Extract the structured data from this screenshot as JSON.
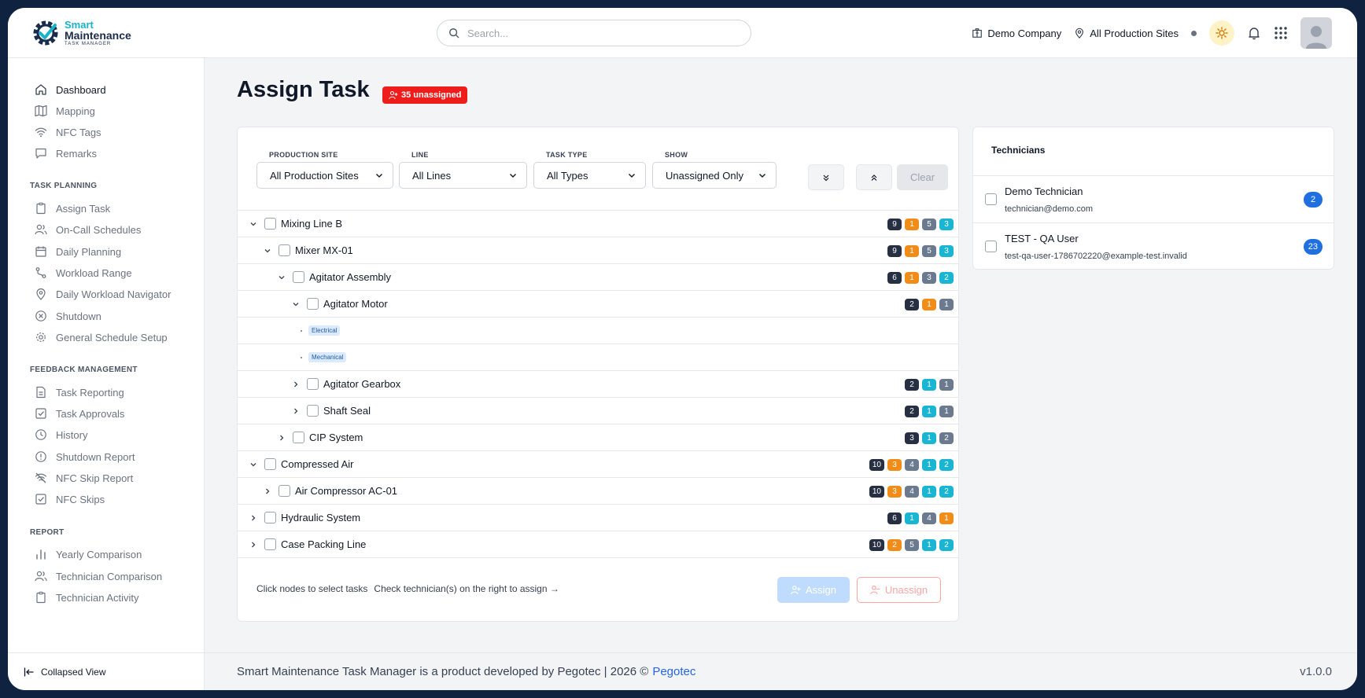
{
  "brand": {
    "line1": "Smart",
    "line2": "Maintenance",
    "line3": "TASK MANAGER"
  },
  "search": {
    "placeholder": "Search..."
  },
  "header": {
    "company": "Demo Company",
    "sites": "All Production Sites"
  },
  "sidebar": {
    "main": [
      "Dashboard",
      "Mapping",
      "NFC Tags",
      "Remarks"
    ],
    "planning_heading": "TASK PLANNING",
    "planning": [
      "Assign Task",
      "On-Call Schedules",
      "Daily Planning",
      "Workload Range",
      "Daily Workload Navigator",
      "Shutdown",
      "General Schedule Setup"
    ],
    "feedback_heading": "FEEDBACK MANAGEMENT",
    "feedback": [
      "Task Reporting",
      "Task Approvals",
      "History",
      "Shutdown Report",
      "NFC Skip Report",
      "NFC Skips"
    ],
    "report_heading": "REPORT",
    "report": [
      "Yearly Comparison",
      "Technician Comparison",
      "Technician Activity"
    ],
    "collapse": "Collapsed View"
  },
  "page": {
    "title": "Assign Task",
    "unassigned_badge": "35 unassigned"
  },
  "filters": {
    "site": {
      "label": "PRODUCTION SITE",
      "value": "All Production Sites"
    },
    "line": {
      "label": "LINE",
      "value": "All Lines"
    },
    "type": {
      "label": "TASK TYPE",
      "value": "All Types"
    },
    "show": {
      "label": "SHOW",
      "value": "Unassigned Only"
    },
    "clear": "Clear"
  },
  "tree": [
    {
      "label": "Mixing Line B",
      "level": 0,
      "state": "open",
      "counts": [
        [
          "9",
          "dark"
        ],
        [
          "1",
          "orange"
        ],
        [
          "5",
          "gray"
        ],
        [
          "3",
          "cyan"
        ]
      ]
    },
    {
      "label": "Mixer MX-01",
      "level": 1,
      "state": "open",
      "counts": [
        [
          "9",
          "dark"
        ],
        [
          "1",
          "orange"
        ],
        [
          "5",
          "gray"
        ],
        [
          "3",
          "cyan"
        ]
      ]
    },
    {
      "label": "Agitator Assembly",
      "level": 2,
      "state": "open",
      "counts": [
        [
          "6",
          "dark"
        ],
        [
          "1",
          "orange"
        ],
        [
          "3",
          "gray"
        ],
        [
          "2",
          "cyan"
        ]
      ]
    },
    {
      "label": "Agitator Motor",
      "level": 3,
      "state": "open",
      "counts": [
        [
          "2",
          "dark"
        ],
        [
          "1",
          "orange"
        ],
        [
          "1",
          "gray"
        ]
      ]
    },
    {
      "tag": "Electrical",
      "level": 4
    },
    {
      "tag": "Mechanical",
      "level": 4
    },
    {
      "label": "Agitator Gearbox",
      "level": 3,
      "state": "closed",
      "counts": [
        [
          "2",
          "dark"
        ],
        [
          "1",
          "cyan"
        ],
        [
          "1",
          "gray"
        ]
      ]
    },
    {
      "label": "Shaft Seal",
      "level": 3,
      "state": "closed",
      "counts": [
        [
          "2",
          "dark"
        ],
        [
          "1",
          "cyan"
        ],
        [
          "1",
          "gray"
        ]
      ]
    },
    {
      "label": "CIP System",
      "level": 2,
      "state": "closed",
      "counts": [
        [
          "3",
          "dark"
        ],
        [
          "1",
          "cyan"
        ],
        [
          "2",
          "gray"
        ]
      ]
    },
    {
      "label": "Compressed Air",
      "level": 0,
      "state": "open",
      "counts": [
        [
          "10",
          "dark"
        ],
        [
          "3",
          "orange"
        ],
        [
          "4",
          "gray"
        ],
        [
          "1",
          "cyan"
        ],
        [
          "2",
          "cyan"
        ]
      ]
    },
    {
      "label": "Air Compressor AC-01",
      "level": 1,
      "state": "closed",
      "counts": [
        [
          "10",
          "dark"
        ],
        [
          "3",
          "orange"
        ],
        [
          "4",
          "gray"
        ],
        [
          "1",
          "cyan"
        ],
        [
          "2",
          "cyan"
        ]
      ]
    },
    {
      "label": "Hydraulic System",
      "level": 0,
      "state": "closed",
      "counts": [
        [
          "6",
          "dark"
        ],
        [
          "1",
          "cyan"
        ],
        [
          "4",
          "gray"
        ],
        [
          "1",
          "orange"
        ]
      ]
    },
    {
      "label": "Case Packing Line",
      "level": 0,
      "state": "closed",
      "counts": [
        [
          "10",
          "dark"
        ],
        [
          "2",
          "orange"
        ],
        [
          "5",
          "gray"
        ],
        [
          "1",
          "cyan"
        ],
        [
          "2",
          "cyan"
        ]
      ]
    }
  ],
  "card_footer": {
    "hint1": "Click nodes to select tasks",
    "hint2": "Check technician(s) on the right to assign →",
    "assign": "Assign",
    "unassign": "Unassign"
  },
  "technicians": {
    "title": "Technicians",
    "list": [
      {
        "name": "Demo Technician",
        "email": "technician@demo.com",
        "count": "2"
      },
      {
        "name": "TEST - QA User",
        "email": "test-qa-user-1786702220@example-test.invalid",
        "count": "23"
      }
    ]
  },
  "footer": {
    "text": "Smart Maintenance Task Manager is a product developed by Pegotec | 2026 ©",
    "link": "Pegotec",
    "version": "v1.0.0"
  },
  "colors": {
    "accent": "#19b3c9",
    "navy": "#1a2b4c",
    "danger": "#ef1c1c",
    "primary": "#1f6fe0"
  }
}
